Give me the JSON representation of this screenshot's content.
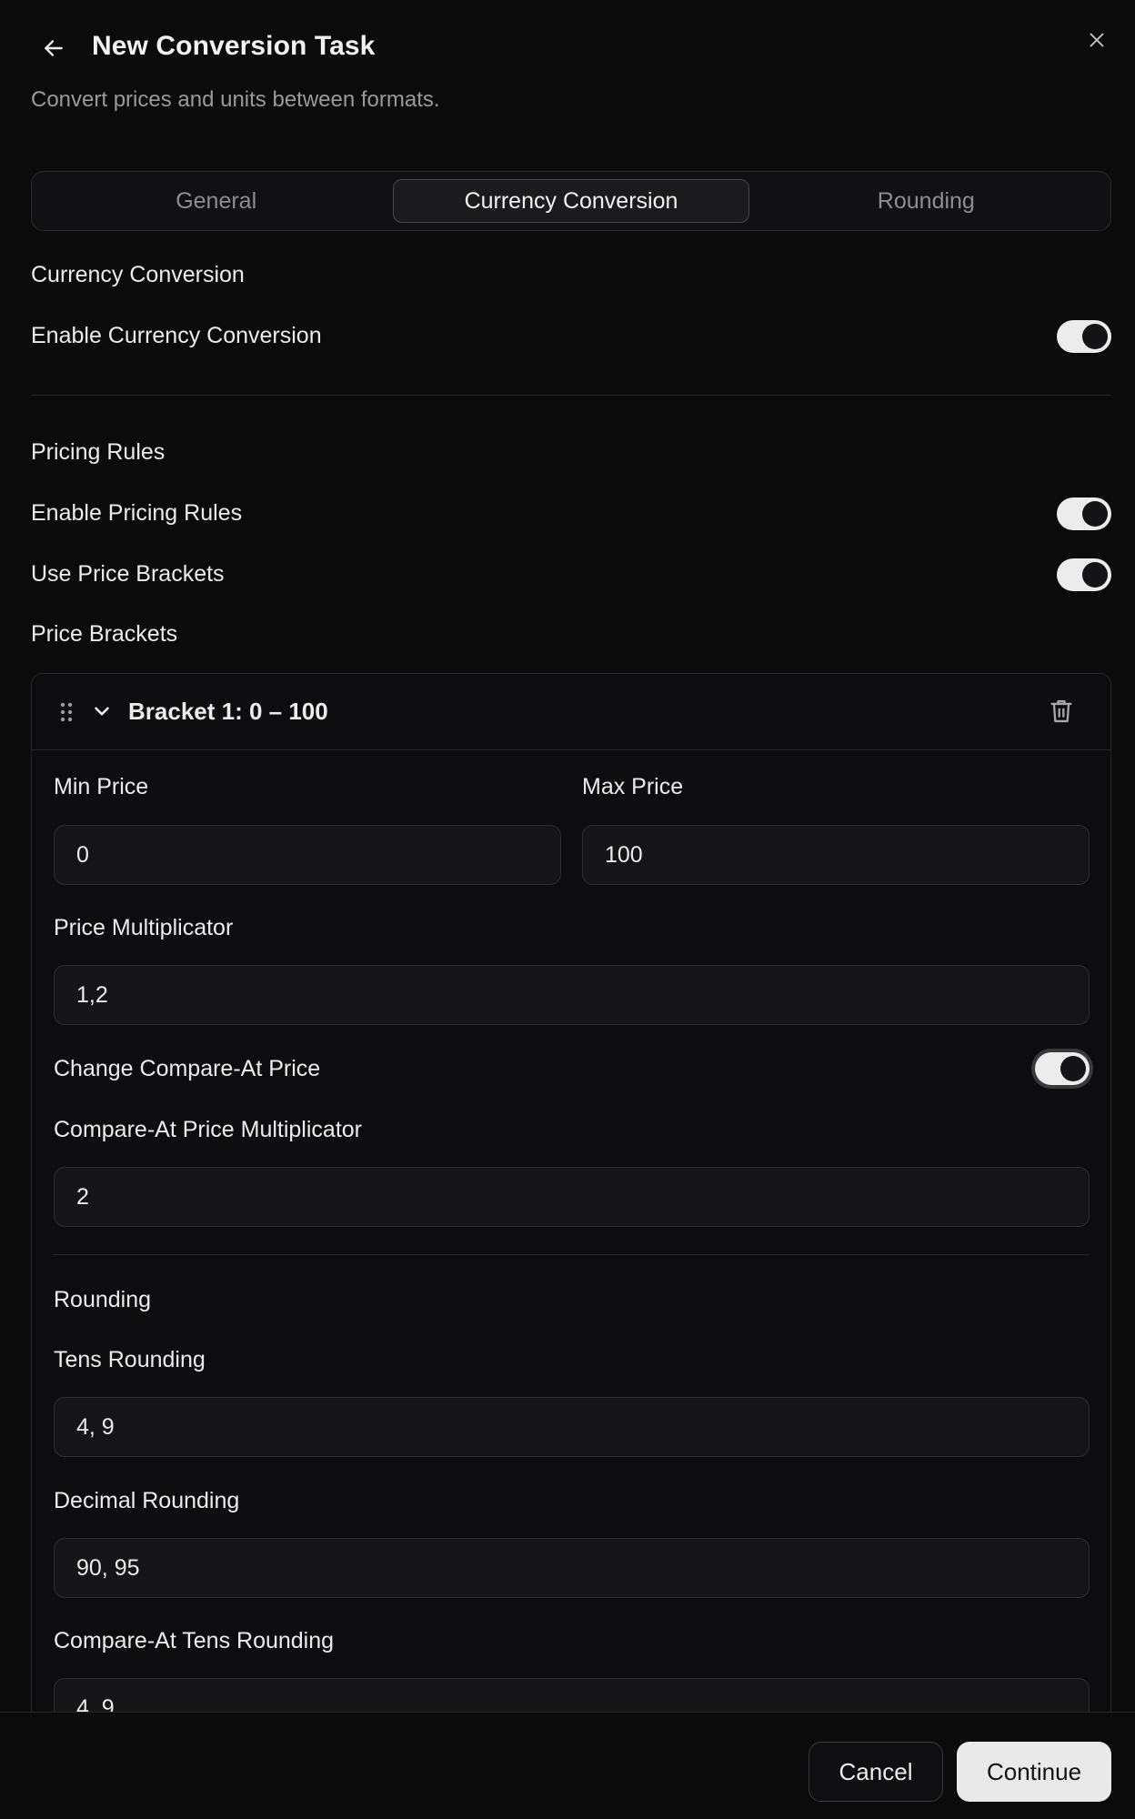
{
  "header": {
    "title": "New Conversion Task",
    "subtitle": "Convert prices and units between formats."
  },
  "tabs": [
    {
      "label": "General",
      "active": false
    },
    {
      "label": "Currency Conversion",
      "active": true
    },
    {
      "label": "Rounding",
      "active": false
    }
  ],
  "currency_section": {
    "heading": "Currency Conversion",
    "enable_label": "Enable Currency Conversion",
    "enable_on": true
  },
  "pricing_section": {
    "heading": "Pricing Rules",
    "enable_label": "Enable Pricing Rules",
    "enable_on": true,
    "brackets_toggle_label": "Use Price Brackets",
    "brackets_toggle_on": true,
    "brackets_heading": "Price Brackets"
  },
  "bracket": {
    "title": "Bracket 1: 0 – 100",
    "min_price_label": "Min Price",
    "min_price_value": "0",
    "max_price_label": "Max Price",
    "max_price_value": "100",
    "multiplicator_label": "Price Multiplicator",
    "multiplicator_value": "1,2",
    "compare_toggle_label": "Change Compare-At Price",
    "compare_toggle_on": true,
    "compare_multiplicator_label": "Compare-At Price Multiplicator",
    "compare_multiplicator_value": "2",
    "rounding_heading": "Rounding",
    "tens_rounding_label": "Tens Rounding",
    "tens_rounding_value": "4, 9",
    "decimal_rounding_label": "Decimal Rounding",
    "decimal_rounding_value": "90, 95",
    "compare_tens_rounding_label": "Compare-At Tens Rounding",
    "compare_tens_rounding_value": "4, 9"
  },
  "footer": {
    "cancel_label": "Cancel",
    "continue_label": "Continue"
  }
}
